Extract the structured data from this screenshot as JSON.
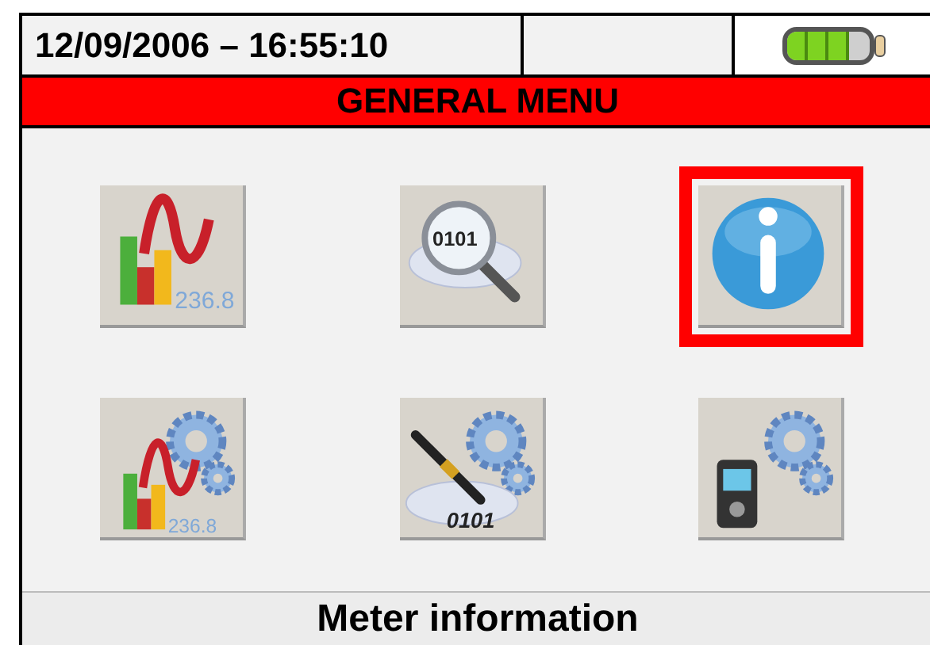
{
  "header": {
    "datetime": "12/09/2006 – 16:55:10",
    "battery": {
      "level": 0.75
    }
  },
  "title": "GENERAL MENU",
  "tiles": [
    {
      "kind": "analyzer",
      "icon_text": "236.8",
      "selected": false
    },
    {
      "kind": "recall",
      "icon_text": "0101",
      "selected": false
    },
    {
      "kind": "info",
      "selected": true
    },
    {
      "kind": "analyzer-settings",
      "icon_text": "236.8",
      "selected": false
    },
    {
      "kind": "recording-settings",
      "icon_text": "0101",
      "selected": false
    },
    {
      "kind": "meter-settings",
      "selected": false
    }
  ],
  "status": "Meter information"
}
